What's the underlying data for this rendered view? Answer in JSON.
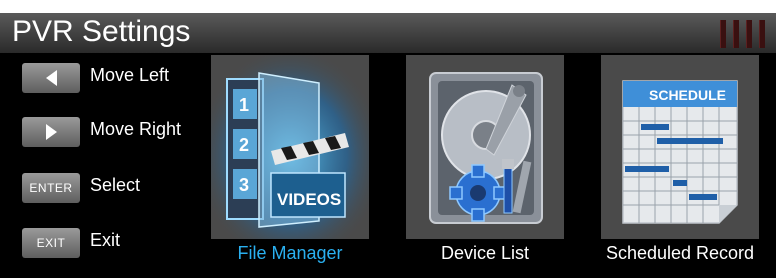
{
  "header": {
    "title": "PVR Settings"
  },
  "hints": [
    {
      "key_label": "",
      "icon": "arrow-left-icon",
      "label": "Move Left"
    },
    {
      "key_label": "",
      "icon": "arrow-right-icon",
      "label": "Move Right"
    },
    {
      "key_label": "ENTER",
      "label": "Select"
    },
    {
      "key_label": "EXIT",
      "label": "Exit"
    }
  ],
  "tiles": [
    {
      "label": "File Manager",
      "icon": "videos-film-icon",
      "selected": true,
      "icon_text": "VIDEOS",
      "numbers": [
        "1",
        "2",
        "3"
      ]
    },
    {
      "label": "Device List",
      "icon": "hard-drive-tools-icon",
      "selected": false
    },
    {
      "label": "Scheduled Record",
      "icon": "schedule-calendar-icon",
      "selected": false,
      "icon_text": "SCHEDULE"
    }
  ],
  "colors": {
    "selected_label": "#2ab0f0",
    "background": "#000000",
    "tile_bg": "#4a4a4a"
  }
}
